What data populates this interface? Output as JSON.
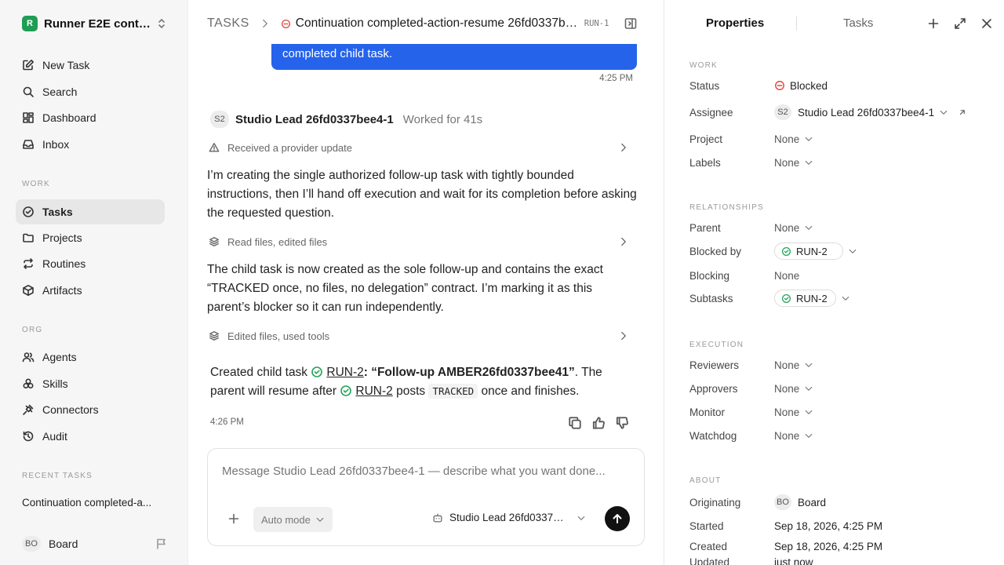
{
  "sidebar": {
    "workspace": {
      "logo": "R",
      "name": "Runner E2E conti..."
    },
    "items_top": [
      {
        "label": "New Task",
        "icon": "edit-icon"
      },
      {
        "label": "Search",
        "icon": "search-icon"
      },
      {
        "label": "Dashboard",
        "icon": "dashboard-icon"
      },
      {
        "label": "Inbox",
        "icon": "inbox-icon"
      }
    ],
    "work_header": "WORK",
    "items_work": [
      {
        "label": "Tasks",
        "icon": "check-circle-icon",
        "active": true
      },
      {
        "label": "Projects",
        "icon": "folder-icon"
      },
      {
        "label": "Routines",
        "icon": "repeat-icon"
      },
      {
        "label": "Artifacts",
        "icon": "box-icon"
      }
    ],
    "org_header": "ORG",
    "items_org": [
      {
        "label": "Agents",
        "icon": "users-icon"
      },
      {
        "label": "Skills",
        "icon": "skills-icon"
      },
      {
        "label": "Connectors",
        "icon": "plug-icon"
      },
      {
        "label": "Audit",
        "icon": "history-icon"
      }
    ],
    "recent_header": "RECENT TASKS",
    "recent_task": "Continuation completed-a...",
    "user": {
      "initials": "BO",
      "name": "Board"
    }
  },
  "header": {
    "root": "TASKS",
    "title": "Continuation completed-action-resume 26fd0337be...",
    "task_id": "RUN-1"
  },
  "thread": {
    "user_bubble": "completed child task.",
    "user_time": "4:25 PM",
    "agent": {
      "initials": "S2",
      "name": "Studio Lead 26fd0337bee4-1",
      "worked": "Worked for 41s"
    },
    "step1": "Received a provider update",
    "para1": "I’m creating the single authorized follow-up task with tightly bounded instructions, then I’ll hand off execution and wait for its completion before asking the requested question.",
    "step2": "Read files, edited files",
    "para2": "The child task is now created as the sole follow-up and contains the exact “TRACKED once, no files, no delegation” contract. I’m marking it as this parent’s blocker so it can run independently.",
    "step3": "Edited files, used tools",
    "result": {
      "prefix": "Created child task",
      "link": "RUN-2",
      "title": ": “Follow-up AMBER26fd0337bee41”",
      "mid": ". The parent will resume after",
      "link2": "RUN-2",
      "posts": "posts",
      "code": "TRACKED",
      "suffix": "once and finishes."
    },
    "agent_time": "4:26 PM"
  },
  "composer": {
    "placeholder": "Message Studio Lead 26fd0337bee4-1 — describe what you want done...",
    "mode": "Auto mode",
    "agent": "Studio Lead 26fd0337be..."
  },
  "props": {
    "tab_properties": "Properties",
    "tab_tasks": "Tasks",
    "work_header": "WORK",
    "status_label": "Status",
    "status_value": "Blocked",
    "assignee_label": "Assignee",
    "assignee_initials": "S2",
    "assignee_value": "Studio Lead 26fd0337bee4-1",
    "project_label": "Project",
    "project_value": "None",
    "labels_label": "Labels",
    "labels_value": "None",
    "rel_header": "RELATIONSHIPS",
    "parent_label": "Parent",
    "parent_value": "None",
    "blockedby_label": "Blocked by",
    "blockedby_value": "RUN-2",
    "blocking_label": "Blocking",
    "blocking_value": "None",
    "subtasks_label": "Subtasks",
    "subtasks_value": "RUN-2",
    "exec_header": "EXECUTION",
    "reviewers_label": "Reviewers",
    "reviewers_value": "None",
    "approvers_label": "Approvers",
    "approvers_value": "None",
    "monitor_label": "Monitor",
    "monitor_value": "None",
    "watchdog_label": "Watchdog",
    "watchdog_value": "None",
    "about_header": "ABOUT",
    "orig_label": "Originating",
    "orig_initials": "BO",
    "orig_value": "Board",
    "started_label": "Started",
    "started_value": "Sep 18, 2026, 4:25 PM",
    "created_label": "Created",
    "created_value": "Sep 18, 2026, 4:25 PM",
    "updated_label": "Updated",
    "updated_value": "just now"
  },
  "colors": {
    "accent": "#2563eb",
    "blocked": "#e0483e",
    "done": "#22a35a",
    "brand": "#1f9d55"
  }
}
